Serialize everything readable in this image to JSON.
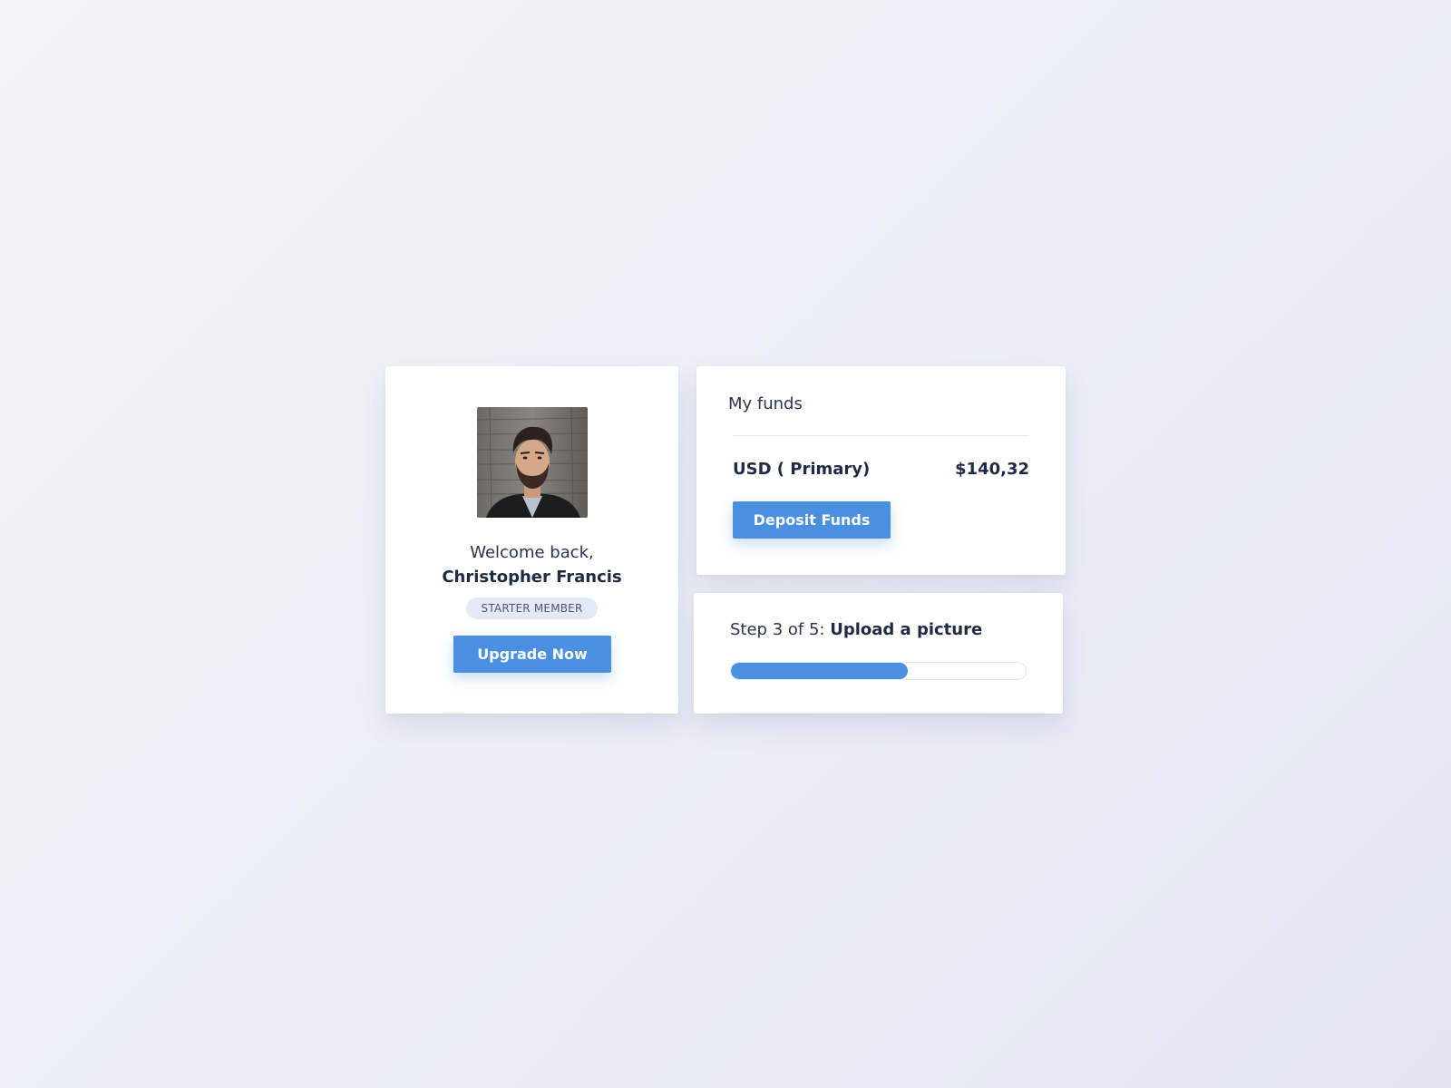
{
  "profile": {
    "welcome_text": "Welcome back,",
    "user_name": "Christopher Francis",
    "membership_badge": "STARTER MEMBER",
    "upgrade_label": "Upgrade Now",
    "avatar_icon": "avatar-photo"
  },
  "funds": {
    "title": "My funds",
    "currency_label": "USD ( Primary)",
    "balance": "$140,32",
    "deposit_label": "Deposit Funds"
  },
  "progress": {
    "step_prefix": "Step 3 of 5:",
    "step_title": "Upload a picture",
    "fraction": 0.6
  },
  "colors": {
    "accent": "#4a8fe0",
    "text_dark": "#1f2a44",
    "badge_bg": "#e4e9f6",
    "page_bg": "#eceff7"
  }
}
